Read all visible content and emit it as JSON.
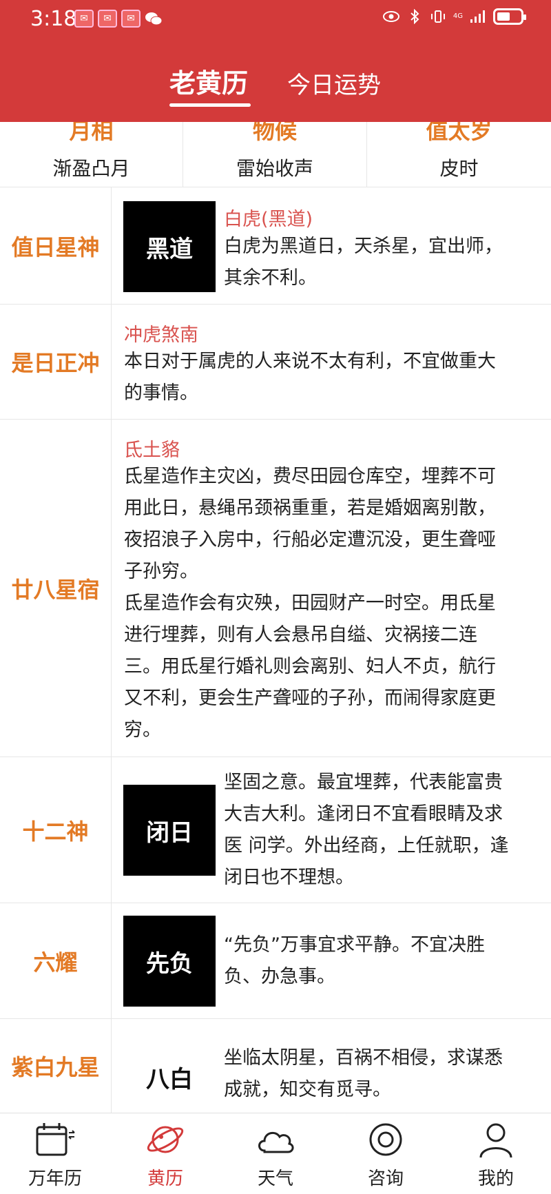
{
  "status_bar": {
    "time": "3:18",
    "notif_icons": [
      "red-envelope-icon",
      "red-envelope-icon",
      "red-envelope-icon",
      "wechat-icon"
    ],
    "network_label": "4G"
  },
  "header": {
    "tab_active": "老黄历",
    "tab_other": "今日运势",
    "bg_color": "#d33a3a"
  },
  "top_strip": [
    {
      "title": "月相",
      "value": "渐盈凸月"
    },
    {
      "title": "物候",
      "value": "雷始收声"
    },
    {
      "title": "值太岁",
      "value": "皮时"
    }
  ],
  "rows": {
    "xingshen": {
      "label": "值日星神",
      "badge": "黑道",
      "subtitle": "白虎(黑道)",
      "lines": [
        "白虎为黑道日，天杀星，宜出师，",
        "其余不利。"
      ]
    },
    "zhengchong": {
      "label": "是日正冲",
      "subtitle": "冲虎煞南",
      "lines": [
        "本日对于属虎的人来说不太有利，不宜做重大",
        "的事情。"
      ]
    },
    "xingxiu": {
      "label": "廿八星宿",
      "subtitle": "氐土貉",
      "lines": [
        "氐星造作主灾凶，费尽田园仓库空，埋葬不可",
        "用此日，悬绳吊颈祸重重，若是婚姻离别散，",
        "夜招浪子入房中，行船必定遭沉没，更生聋哑",
        "子孙穷。",
        "氐星造作会有灾殃，田园财产一时空。用氐星",
        "进行埋葬，则有人会悬吊自缢、灾祸接二连",
        "三。用氐星行婚礼则会离别、妇人不贞，航行",
        "又不利，更会生产聋哑的子孙，而闹得家庭更",
        "穷。"
      ]
    },
    "shiershen": {
      "label": "十二神",
      "badge": "闭日",
      "lines": [
        "坚固之意。最宜埋葬，代表能富贵",
        "大吉大利。逢闭日不宜看眼睛及求",
        "医 问学。外出经商，上任就职，逢",
        "闭日也不理想。"
      ]
    },
    "liuyao": {
      "label": "六耀",
      "badge": "先负",
      "lines": [
        "“先负”万事宜求平静。不宜决胜",
        "负、办急事。"
      ]
    },
    "jiuxing": {
      "label": "紫白九星",
      "badge": "八白",
      "lines": [
        "坐临太阴星，百祸不相侵，求谋悉",
        "成就，知交有觅寻。"
      ]
    }
  },
  "bottom_nav": [
    {
      "label": "万年历",
      "icon": "calendar-icon",
      "active": false
    },
    {
      "label": "黄历",
      "icon": "planet-icon",
      "active": true
    },
    {
      "label": "天气",
      "icon": "cloud-icon",
      "active": false
    },
    {
      "label": "咨询",
      "icon": "consult-icon",
      "active": false
    },
    {
      "label": "我的",
      "icon": "person-icon",
      "active": false
    }
  ],
  "colors": {
    "accent_red": "#d33a3a",
    "label_orange": "#e37a25",
    "subtitle_red": "#d9534f"
  }
}
